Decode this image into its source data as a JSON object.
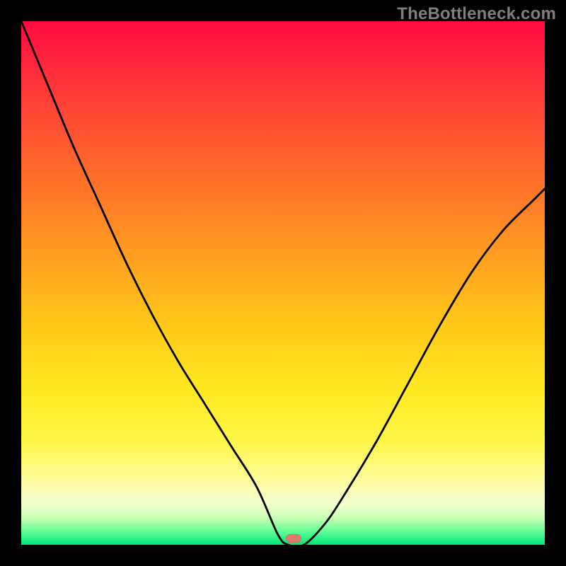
{
  "watermark": "TheBottleneck.com",
  "chart_data": {
    "type": "line",
    "title": "",
    "xlabel": "",
    "ylabel": "",
    "xlim": [
      0,
      100
    ],
    "ylim": [
      0,
      100
    ],
    "grid": false,
    "legend": false,
    "background": {
      "type": "vertical-gradient",
      "stops": [
        {
          "pos": 0,
          "color": "#ff0b40"
        },
        {
          "pos": 22,
          "color": "#ff5630"
        },
        {
          "pos": 46,
          "color": "#ffa220"
        },
        {
          "pos": 70,
          "color": "#ffe820"
        },
        {
          "pos": 88,
          "color": "#fffca0"
        },
        {
          "pos": 95,
          "color": "#c6ffb2"
        },
        {
          "pos": 100,
          "color": "#00e676"
        }
      ]
    },
    "series": [
      {
        "name": "bottleneck-curve",
        "color": "#000000",
        "x": [
          0,
          5,
          10,
          15,
          20,
          25,
          30,
          35,
          40,
          45,
          49,
          51,
          54,
          58,
          62,
          68,
          74,
          80,
          86,
          92,
          98,
          100
        ],
        "y": [
          100,
          88,
          76,
          65,
          54,
          44,
          35,
          27,
          19,
          11,
          2,
          0,
          0,
          4,
          10,
          20,
          31,
          42,
          52,
          60,
          66,
          68
        ]
      }
    ],
    "marker": {
      "name": "optimum-point",
      "x": 52,
      "y": 1,
      "color": "#e07a6a"
    }
  }
}
